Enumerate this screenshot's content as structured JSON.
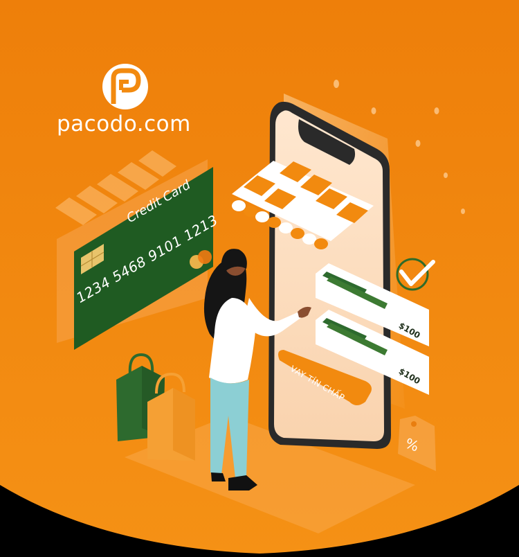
{
  "brand": {
    "name": "pacodo.com",
    "logo_letter": "P"
  },
  "card": {
    "title": "Credit Card",
    "number": "1234 5468 9101 1213"
  },
  "offers": [
    {
      "price": "$100"
    },
    {
      "price": "$100"
    }
  ],
  "cta": {
    "label": "VAY TÍN CHẤP"
  },
  "tag": {
    "symbol": "%"
  },
  "colors": {
    "background": "#F28A0F",
    "card": "#1F5B22",
    "bag_green": "#2D6A2E",
    "bag_orange": "#F5A034",
    "accent_white": "#FFFFFF",
    "check_green": "#2F6B2A"
  },
  "icons": [
    "logo-icon",
    "chevrons-icon",
    "chip-icon",
    "checkmark-icon",
    "percent-tag-icon",
    "shopping-bag-icon"
  ]
}
